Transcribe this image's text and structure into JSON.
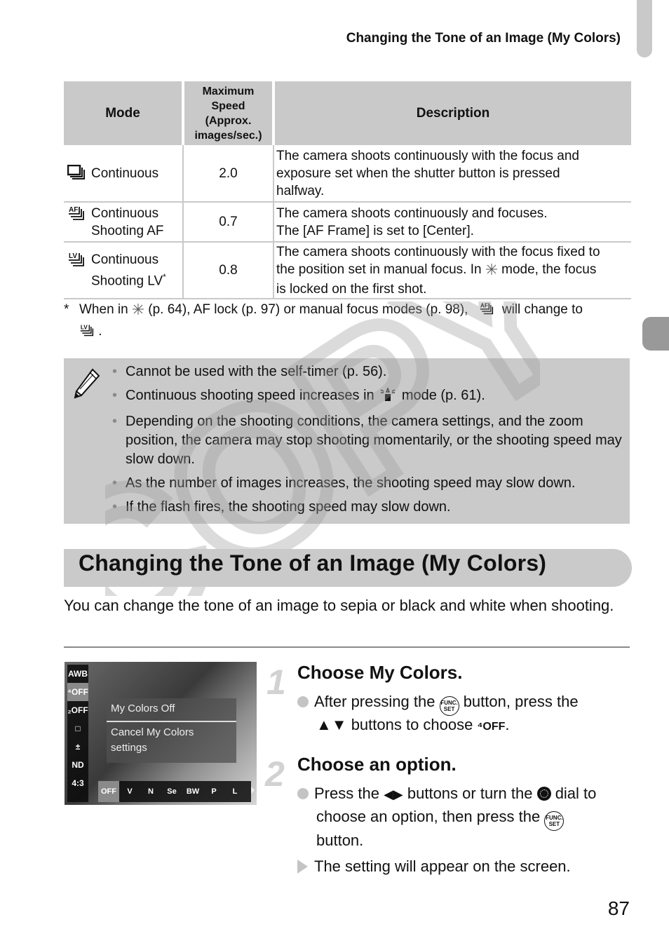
{
  "header": {
    "running_title": "Changing the Tone of an Image (My Colors)"
  },
  "table": {
    "columns": [
      "Mode",
      "Maximum Speed (Approx. images/sec.)",
      "Description"
    ],
    "speed_header_lines": [
      "Maximum",
      "Speed",
      "(Approx.",
      "images/sec.)"
    ],
    "rows": [
      {
        "icon": "continuous-shooting-icon",
        "mode_lines": [
          "Continuous"
        ],
        "mode_footnote_mark": "",
        "speed": "2.0",
        "description_lines": [
          "The camera shoots continuously with the focus and",
          "exposure set when the shutter button is pressed",
          "halfway."
        ]
      },
      {
        "icon": "continuous-af-icon",
        "mode_lines": [
          "Continuous",
          "Shooting AF"
        ],
        "mode_footnote_mark": "",
        "speed": "0.7",
        "description_lines": [
          "The camera shoots continuously and focuses.",
          "The [AF Frame] is set to [Center]."
        ]
      },
      {
        "icon": "continuous-lv-icon",
        "mode_lines": [
          "Continuous",
          "Shooting LV"
        ],
        "mode_footnote_mark": "*",
        "speed": "0.8",
        "description_lines": [
          "The camera shoots continuously with the focus fixed to",
          "the position set in manual focus. In",
          "mode, the focus",
          "is locked on the first shot."
        ]
      }
    ]
  },
  "footnote": {
    "mark": "*",
    "text_a": "When in",
    "text_b": "(p. 64), AF lock (p. 97) or manual focus modes (p. 98),",
    "text_c": "will change to",
    "text_d": "."
  },
  "note": {
    "items": [
      "Cannot be used with the self-timer (p. 56).",
      "Continuous shooting speed increases in",
      "Depending on the shooting conditions, the camera settings, and the zoom position, the camera may stop shooting momentarily, or the shooting speed may slow down.",
      "As the number of images increases, the shooting speed may slow down.",
      "If the flash fires, the shooting speed may slow down."
    ],
    "item2_suffix": "mode (p. 61)."
  },
  "watermark": "COPY",
  "section": {
    "title": "Changing the Tone of an Image (My Colors)",
    "intro": "You can change the tone of an image to sepia or black and white when shooting."
  },
  "screen": {
    "left_menu": [
      "AWB",
      "⁴OFF",
      "₂OFF",
      "□",
      "±",
      "ND",
      "4:3"
    ],
    "menu_title": "My Colors Off",
    "menu_desc_lines": [
      "Cancel My Colors",
      "settings"
    ],
    "bottom_options": [
      "OFF",
      "V",
      "N",
      "Se",
      "BW",
      "P",
      "L"
    ]
  },
  "steps": [
    {
      "number": "1",
      "title": "Choose My Colors.",
      "line1_a": "After pressing the",
      "line1_b": "button, press the",
      "line2_arrows": "▲▼",
      "line2_a": "buttons to choose",
      "line2_icon": "⁴OFF",
      "line2_end": "."
    },
    {
      "number": "2",
      "title": "Choose an option.",
      "line1_a": "Press the",
      "line1_arrows": "◀▶",
      "line1_b": "buttons or turn the",
      "line1_c": "dial to",
      "line2_a": "choose an option, then press the",
      "line3": "button.",
      "result": "The setting will appear on the screen."
    }
  ],
  "func_button_label": [
    "FUNC.",
    "SET"
  ],
  "page_number": "87"
}
